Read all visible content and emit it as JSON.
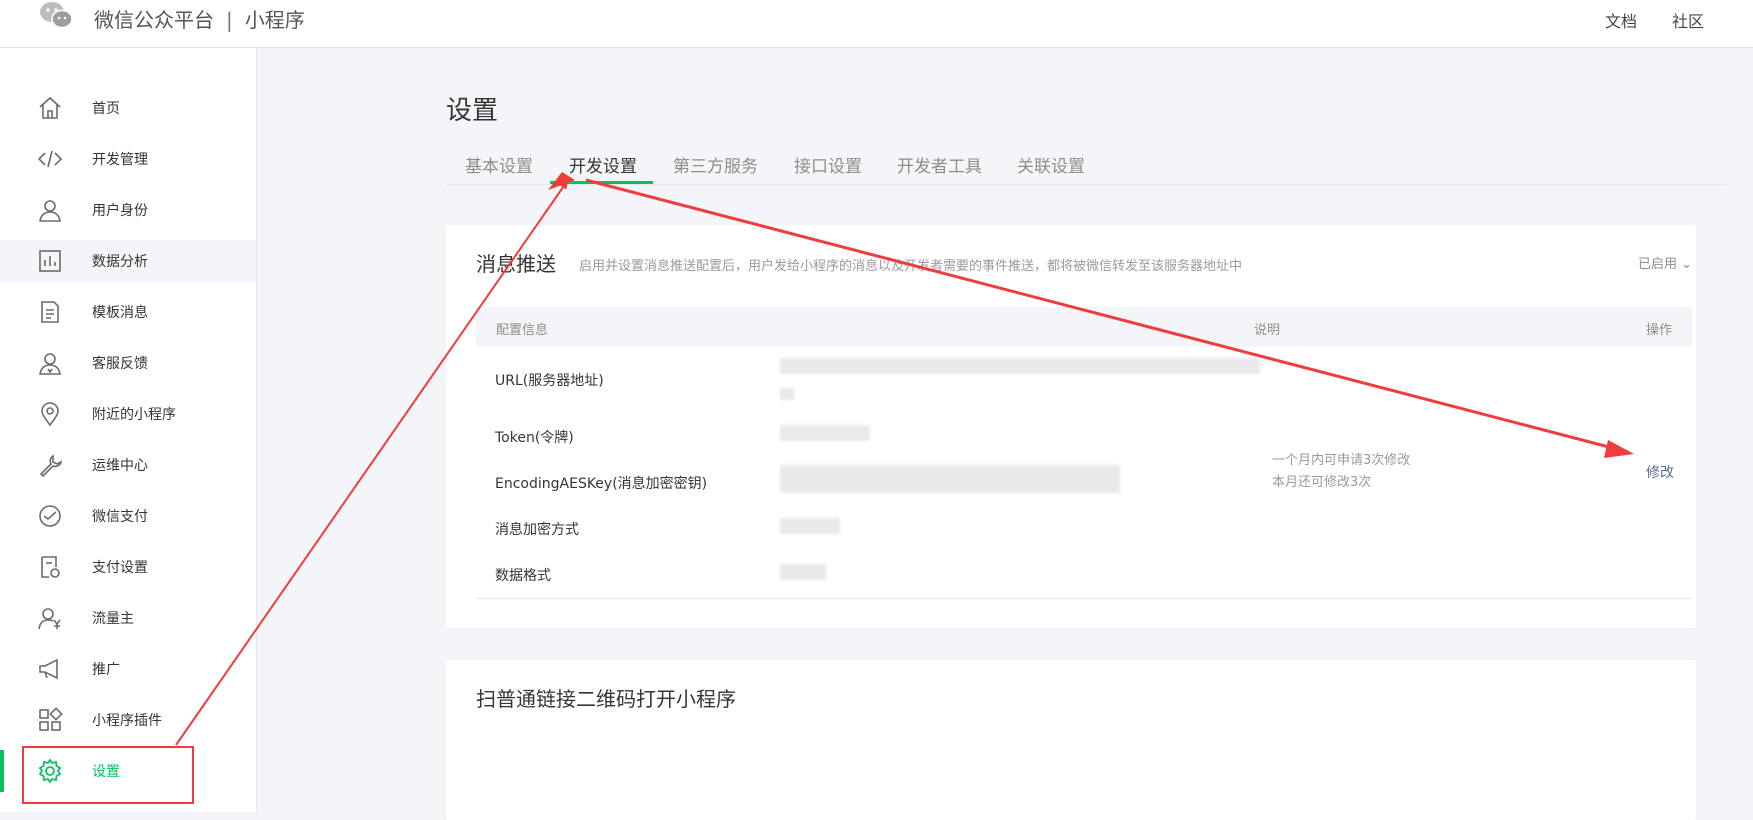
{
  "header": {
    "brand_name": "微信公众平台",
    "separator": "|",
    "product": "小程序",
    "links": [
      "文档",
      "社区"
    ]
  },
  "sidebar": {
    "items": [
      {
        "label": "首页",
        "icon": "home-icon"
      },
      {
        "label": "开发管理",
        "icon": "code-icon"
      },
      {
        "label": "用户身份",
        "icon": "user-icon"
      },
      {
        "label": "数据分析",
        "icon": "bar-chart-icon"
      },
      {
        "label": "模板消息",
        "icon": "document-icon"
      },
      {
        "label": "客服反馈",
        "icon": "support-user-icon"
      },
      {
        "label": "附近的小程序",
        "icon": "location-pin-icon"
      },
      {
        "label": "运维中心",
        "icon": "wrench-icon"
      },
      {
        "label": "微信支付",
        "icon": "pay-icon"
      },
      {
        "label": "支付设置",
        "icon": "pay-settings-icon"
      },
      {
        "label": "流量主",
        "icon": "traffic-owner-icon"
      },
      {
        "label": "推广",
        "icon": "megaphone-icon"
      },
      {
        "label": "小程序插件",
        "icon": "plugin-icon"
      },
      {
        "label": "设置",
        "icon": "gear-icon"
      }
    ],
    "active": "设置",
    "hovered": "数据分析"
  },
  "main": {
    "title": "设置",
    "tabs": [
      "基本设置",
      "开发设置",
      "第三方服务",
      "接口设置",
      "开发者工具",
      "关联设置"
    ],
    "active_tab": "开发设置",
    "message_push": {
      "title": "消息推送",
      "description": "启用并设置消息推送配置后，用户发给小程序的消息以及开发者需要的事件推送，都将被微信转发至该服务器地址中",
      "status": "已启用",
      "table_headers": [
        "配置信息",
        "说明",
        "操作"
      ],
      "rows": [
        "URL(服务器地址)",
        "Token(令牌)",
        "EncodingAESKey(消息加密密钥)",
        "消息加密方式",
        "数据格式"
      ],
      "note_lines": [
        "一个月内可申请3次修改",
        "本月还可修改3次"
      ],
      "action": "修改"
    },
    "qr_section": {
      "title": "扫普通链接二维码打开小程序"
    }
  },
  "colors": {
    "accent": "#07c160",
    "link": "#576b95",
    "annotation": "#f03c3c"
  }
}
